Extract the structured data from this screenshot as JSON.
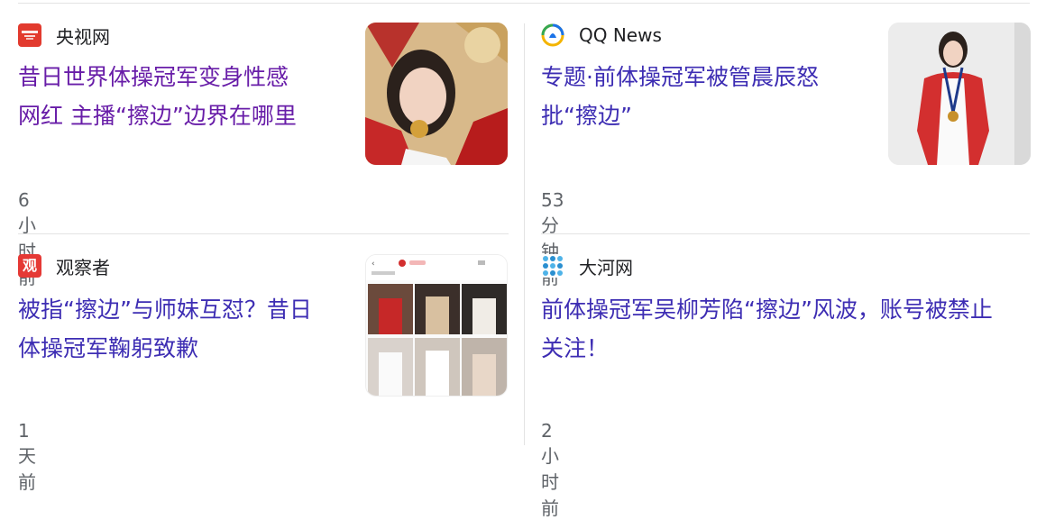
{
  "cards": [
    {
      "source": "央视网",
      "source_icon": "cctv-logo-icon",
      "title_line1": "昔日世界体操冠军变身性感",
      "title_line2": "网红 主播“擦边”边界在哪里",
      "time": "6小时前"
    },
    {
      "source": "QQ News",
      "source_icon": "qq-news-logo-icon",
      "title_line1": "专题·前体操冠军被管晨辰怒",
      "title_line2": "批“擦边”",
      "time": "53分钟前"
    },
    {
      "source": "观察者",
      "source_icon": "guanchazhe-logo-icon",
      "logo_char": "观",
      "title_line1": "被指“擦边”与师妹互怼？昔日",
      "title_line2": "体操冠军鞠躬致歉",
      "time": "1 天前"
    },
    {
      "source": "大河网",
      "source_icon": "dahe-logo-icon",
      "title_line1": "前体操冠军吴柳芳陷“擦边”风波，账号被禁止",
      "title_line2": "关注！",
      "time": "2小时前"
    }
  ],
  "colors": {
    "headline": "#3d2db3",
    "headline_visited": "#681da8",
    "meta": "#5f6368",
    "divider": "#e3e3e3"
  }
}
